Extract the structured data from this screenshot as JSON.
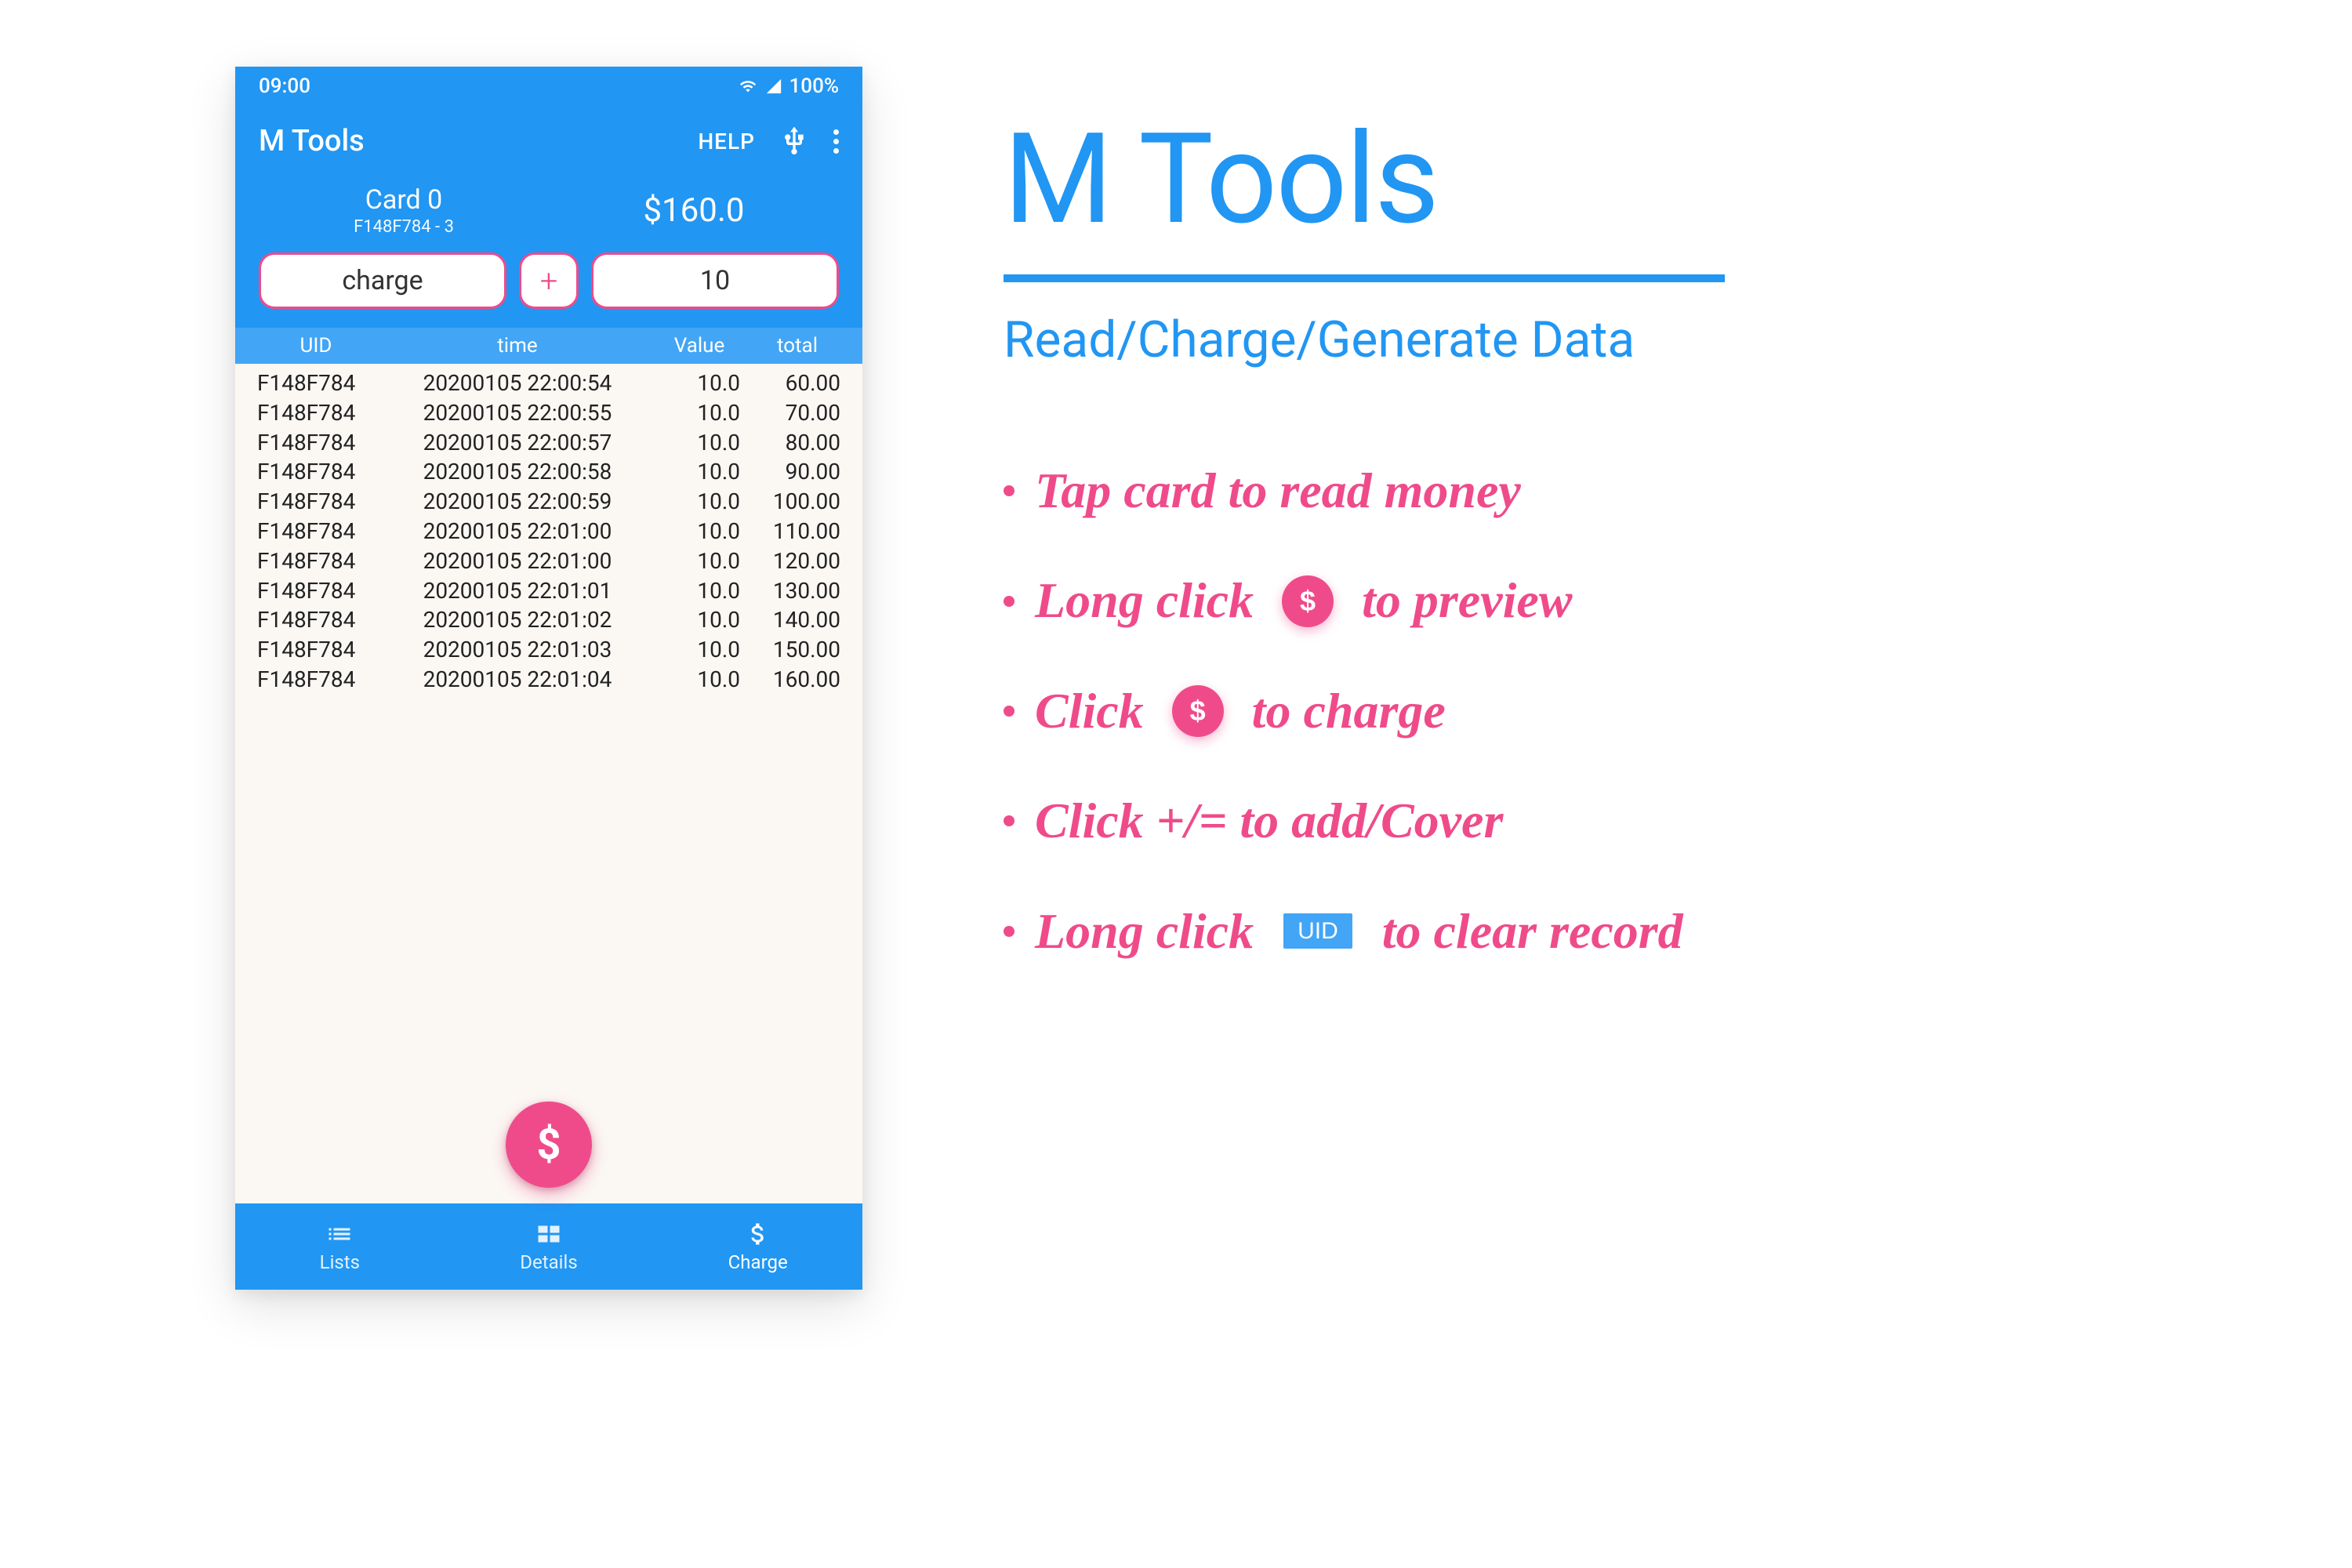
{
  "status": {
    "time": "09:00",
    "battery": "100%"
  },
  "appbar": {
    "title": "M Tools",
    "help": "HELP"
  },
  "card": {
    "name": "Card 0",
    "sub": "F148F784 - 3",
    "balance": "$160.0"
  },
  "charge": {
    "label": "charge",
    "plus": "+",
    "amount": "10"
  },
  "table": {
    "headers": {
      "uid": "UID",
      "time": "time",
      "value": "Value",
      "total": "total"
    },
    "rows": [
      {
        "uid": "F148F784",
        "time": "20200105 22:00:54",
        "value": "10.0",
        "total": "60.00"
      },
      {
        "uid": "F148F784",
        "time": "20200105 22:00:55",
        "value": "10.0",
        "total": "70.00"
      },
      {
        "uid": "F148F784",
        "time": "20200105 22:00:57",
        "value": "10.0",
        "total": "80.00"
      },
      {
        "uid": "F148F784",
        "time": "20200105 22:00:58",
        "value": "10.0",
        "total": "90.00"
      },
      {
        "uid": "F148F784",
        "time": "20200105 22:00:59",
        "value": "10.0",
        "total": "100.00"
      },
      {
        "uid": "F148F784",
        "time": "20200105 22:01:00",
        "value": "10.0",
        "total": "110.00"
      },
      {
        "uid": "F148F784",
        "time": "20200105 22:01:00",
        "value": "10.0",
        "total": "120.00"
      },
      {
        "uid": "F148F784",
        "time": "20200105 22:01:01",
        "value": "10.0",
        "total": "130.00"
      },
      {
        "uid": "F148F784",
        "time": "20200105 22:01:02",
        "value": "10.0",
        "total": "140.00"
      },
      {
        "uid": "F148F784",
        "time": "20200105 22:01:03",
        "value": "10.0",
        "total": "150.00"
      },
      {
        "uid": "F148F784",
        "time": "20200105 22:01:04",
        "value": "10.0",
        "total": "160.00"
      }
    ]
  },
  "fab": "$",
  "nav": {
    "lists": "Lists",
    "details": "Details",
    "charge": "Charge"
  },
  "promo": {
    "title": "M Tools",
    "subtitle": "Read/Charge/Generate Data",
    "uid_chip": "UID",
    "items": {
      "tap": "Tap card to read money",
      "longclick_a": "Long click",
      "longclick_b": "to preview",
      "click_a": "Click",
      "click_b": "to charge",
      "plusminus": "Click +/= to add/Cover",
      "clear_a": "Long click",
      "clear_b": "to clear record"
    }
  }
}
